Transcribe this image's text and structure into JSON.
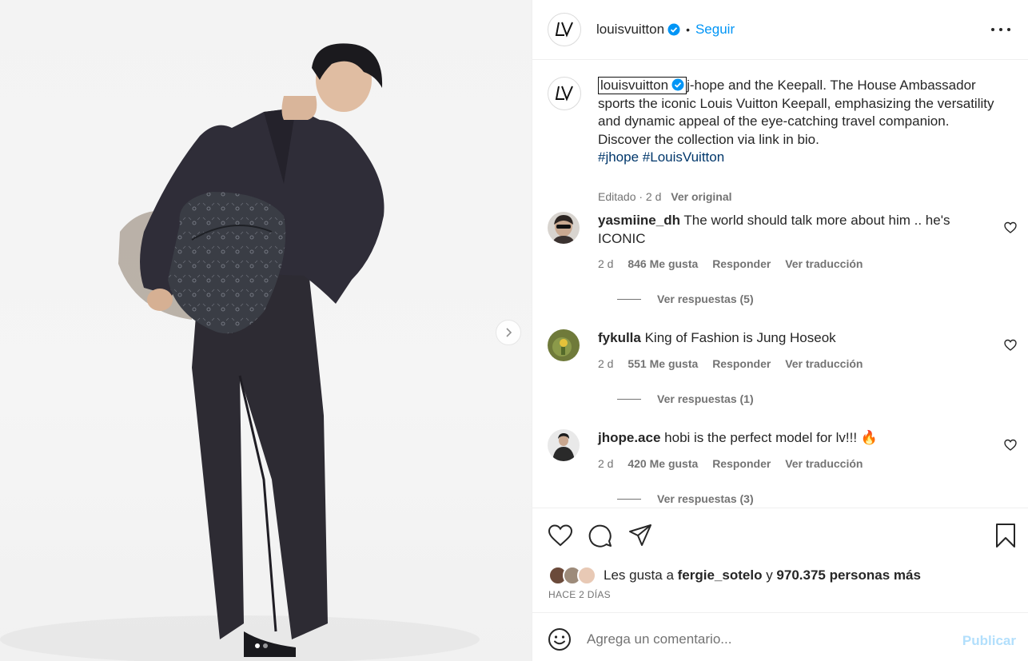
{
  "post": {
    "username": "louisvuitton",
    "separator": "•",
    "follow_label": "Seguir",
    "more_icon": "more-options-icon",
    "verified_color": "#0095f6"
  },
  "caption": {
    "username": "louisvuitton",
    "text": "j-hope and the Keepall. The House Ambassador sports the iconic Louis Vuitton Keepall, emphasizing the versatility and dynamic appeal of the eye-catching travel companion. Discover the collection via link in bio.",
    "hashtags": [
      "#jhope",
      "#LouisVuitton"
    ],
    "meta": "Editado · 2 d",
    "see_original": "Ver original"
  },
  "comments": [
    {
      "username": "yasmiine_dh",
      "text": "The world should talk more about him .. he's ICONIC",
      "age": "2 d",
      "likes": "846 Me gusta",
      "reply": "Responder",
      "translate": "Ver traducción",
      "replies": "Ver respuestas (5)"
    },
    {
      "username": "fykulla",
      "text": "King of Fashion is Jung Hoseok",
      "age": "2 d",
      "likes": "551 Me gusta",
      "reply": "Responder",
      "translate": "Ver traducción",
      "replies": "Ver respuestas (1)"
    },
    {
      "username": "jhope.ace",
      "text": "hobi is the perfect model for lv!!! 🔥",
      "age": "2 d",
      "likes": "420 Me gusta",
      "reply": "Responder",
      "translate": "Ver traducción",
      "replies": "Ver respuestas (3)"
    }
  ],
  "likes": {
    "prefix": "Les gusta a",
    "user": "fergie_sotelo",
    "connector": "y",
    "count": "970.375 personas más"
  },
  "posted": "HACE 2 DÍAS",
  "add_comment": {
    "placeholder": "Agrega un comentario...",
    "publish": "Publicar"
  },
  "carousel": {
    "current": 1,
    "total": 2
  }
}
